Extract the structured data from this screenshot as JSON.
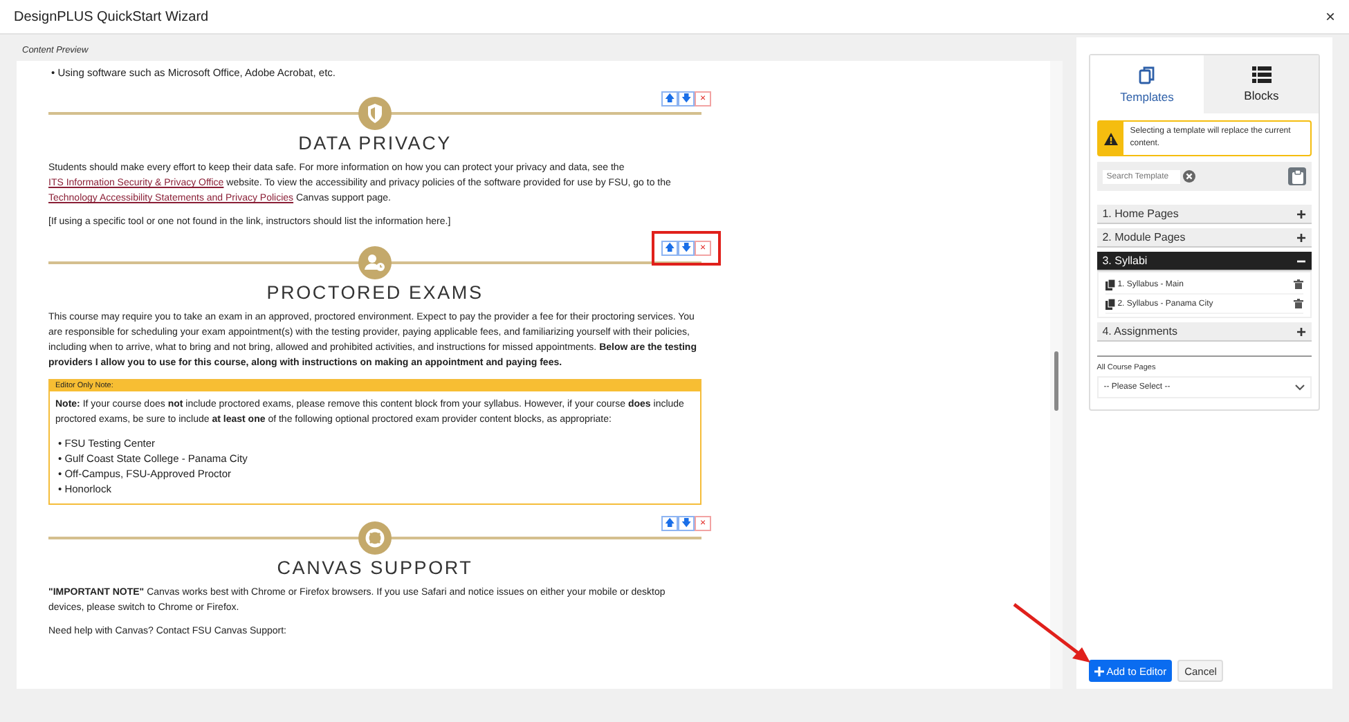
{
  "window": {
    "title": "DesignPLUS QuickStart Wizard",
    "close": "×"
  },
  "preview": {
    "label": "Content Preview",
    "intro_list": [
      "• Using software such as Microsoft Office, Adobe Acrobat, etc."
    ],
    "sections": [
      {
        "title": "DATA PRIVACY",
        "highlighted": false,
        "controls": {
          "up": "🡅",
          "down": "🡇",
          "remove": "×"
        },
        "paragraphs": [
          [
            {
              "text": "Students should make every effort to keep their data safe. For more information on how you can protect your privacy and data, see the ",
              "kind": "text"
            },
            {
              "text": "ITS Information Security & Privacy Office",
              "kind": "link"
            },
            {
              "text": " website. To view the accessibility and privacy policies of the software provided for use by FSU, go to the ",
              "kind": "text"
            },
            {
              "text": "Technology Accessibility Statements and Privacy Policies",
              "kind": "link"
            },
            {
              "text": " Canvas support page.",
              "kind": "text"
            }
          ],
          [
            {
              "text": "[If using a specific tool or one not found in the link, instructors should list the information here.]",
              "kind": "text"
            }
          ]
        ]
      },
      {
        "title": "PROCTORED EXAMS",
        "highlighted": true,
        "controls": {
          "up": "🡅",
          "down": "🡇",
          "remove": "×"
        },
        "paragraphs": [
          [
            {
              "text": "This course may require you to take an exam in an approved, proctored environment. Expect to pay the provider a fee for their proctoring services. You are responsible for scheduling your exam appointment(s) with the testing provider, paying applicable fees, and familiarizing yourself with their policies, including when to arrive, what to bring and not bring, allowed and prohibited activities, and instructions for missed appointments. **Below are the testing providers I allow you to use for this course, along with instructions on making an appointment and paying fees.**",
              "kind": "text"
            }
          ]
        ],
        "note": {
          "label": "Editor Only Note:",
          "text": "**Note:** If your course does **not** include proctored exams, please remove this content block from your syllabus. However, if your course **does** include proctored exams, be sure to include **at least one** of the following optional proctored exam provider content blocks, as appropriate:",
          "items": [
            "• FSU Testing Center",
            "• Gulf Coast State College - Panama City",
            "• Off-Campus, FSU-Approved Proctor",
            "• Honorlock"
          ]
        }
      },
      {
        "title": "CANVAS SUPPORT",
        "highlighted": false,
        "controls": {
          "up": "🡅",
          "down": "🡇",
          "remove": "×"
        },
        "paragraphs": [
          [
            {
              "text": "**\"IMPORTANT NOTE\"** Canvas works best with Chrome or Firefox browsers. If you use Safari and notice issues on either your mobile or desktop devices, please switch to Chrome or Firefox.",
              "kind": "text"
            }
          ],
          [
            {
              "text": "Need help with Canvas? Contact FSU Canvas Support:",
              "kind": "text"
            }
          ]
        ]
      }
    ]
  },
  "sidebar": {
    "tabs": [
      {
        "label": "Templates",
        "selected": true
      },
      {
        "label": "Blocks",
        "selected": false
      }
    ],
    "warning": "Selecting a template will replace the current content.",
    "search": {
      "placeholder": "Search Template"
    },
    "categories": [
      {
        "label": "1. Home Pages",
        "expanded": false,
        "toggle": "+"
      },
      {
        "label": "2. Module Pages",
        "expanded": false,
        "toggle": "+"
      },
      {
        "label": "3. Syllabi",
        "expanded": true,
        "toggle": "−",
        "children": [
          {
            "label": "1. Syllabus - Main"
          },
          {
            "label": "2. Syllabus - Panama City"
          }
        ]
      },
      {
        "label": "4. Assignments",
        "expanded": false,
        "toggle": "+"
      }
    ],
    "course_pages": {
      "label": "All Course Pages",
      "value": "-- Please Select --"
    }
  },
  "buttons": [
    {
      "label": "Add to Editor",
      "kind": "primary",
      "pointed": true
    },
    {
      "label": "Cancel",
      "kind": "secondary",
      "pointed": false
    }
  ]
}
